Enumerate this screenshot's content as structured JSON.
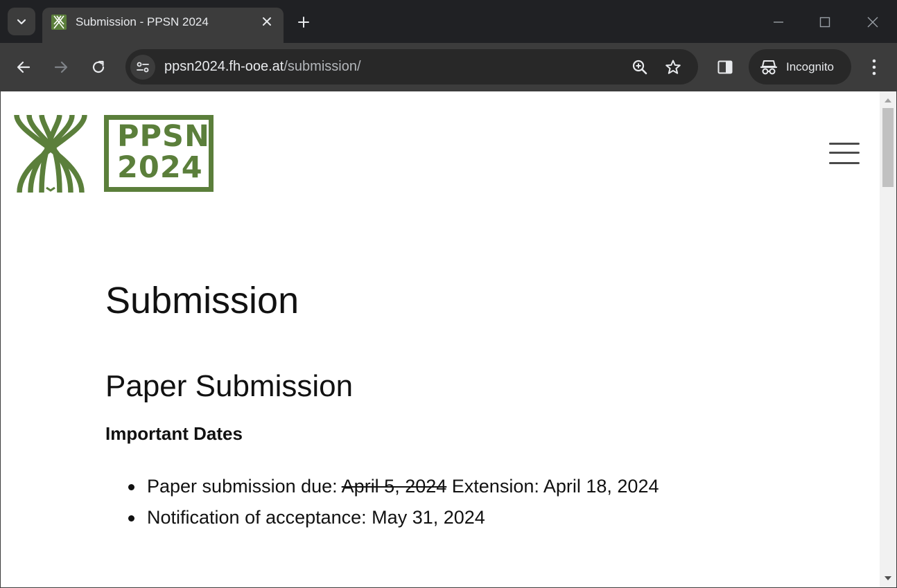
{
  "browser": {
    "tab": {
      "title": "Submission - PPSN 2024",
      "favicon": "ppsn-favicon"
    },
    "address_bar": {
      "host": "ppsn2024.fh-ooe.at",
      "path": "/submission/"
    },
    "incognito_label": "Incognito",
    "colors": {
      "tabstrip": "#202124",
      "toolbar": "#3c3c3c",
      "omnibox": "#282828"
    }
  },
  "page": {
    "logo": {
      "line1": "PPSN",
      "line2": "2024",
      "color": "#5b7f3b"
    },
    "title": "Submission",
    "section_title": "Paper Submission",
    "important_dates_heading": "Important Dates",
    "dates": [
      {
        "label": "Paper submission due: ",
        "old_date": "April 5, 2024",
        "new_text": " Extension: April 18, 2024"
      },
      {
        "label": "Notification of acceptance: May 31, 2024"
      }
    ]
  }
}
